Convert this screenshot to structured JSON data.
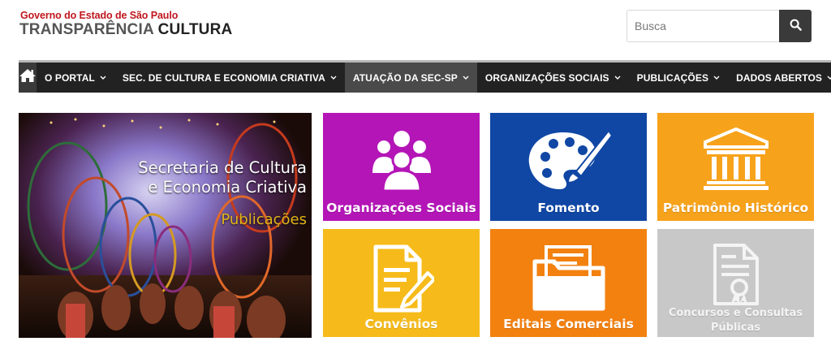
{
  "header": {
    "logo_top": "Governo do Estado de São Paulo",
    "logo_main_a": "TRANSPARÊNCIA ",
    "logo_main_b": "CULTURA"
  },
  "search": {
    "placeholder": "Busca",
    "value": ""
  },
  "nav": {
    "items": [
      {
        "label": "O PORTAL"
      },
      {
        "label": "SEC. DE CULTURA E ECONOMIA CRIATIVA"
      },
      {
        "label": "ATUAÇÃO DA SEC-SP"
      },
      {
        "label": "ORGANIZAÇÕES SOCIAIS"
      },
      {
        "label": "PUBLICAÇÕES"
      },
      {
        "label": "DADOS ABERTOS"
      }
    ],
    "active_index": 2
  },
  "hero": {
    "title_line1": "Secretaria de Cultura",
    "title_line2": "e Economia Criativa",
    "subtitle": "Publicações"
  },
  "tiles": [
    {
      "label": "Organizações Sociais",
      "color": "#b415b7",
      "icon": "people-group-icon"
    },
    {
      "label": "Fomento",
      "color": "#1047a5",
      "icon": "palette-icon"
    },
    {
      "label": "Patrimônio Histórico",
      "color": "#f7a21b",
      "icon": "museum-building-icon"
    },
    {
      "label": "Convênios",
      "color": "#f6bb1a",
      "icon": "document-edit-icon"
    },
    {
      "label": "Editais Comerciais",
      "color": "#f38110",
      "icon": "folder-documents-icon"
    },
    {
      "label_line1": "Concursos e Consultas",
      "label_line2": "Públicas",
      "color": "#c8c8c8",
      "icon": "certificate-icon"
    }
  ],
  "colors": {
    "nav_bg": "#222222",
    "brand_red": "#c0161d"
  }
}
